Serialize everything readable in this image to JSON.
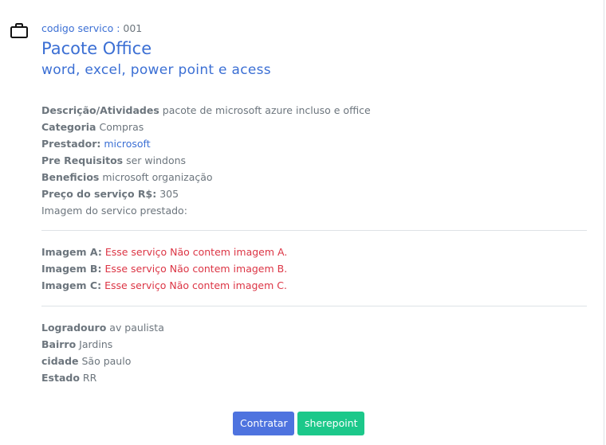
{
  "service": {
    "code_label": "codigo servico :",
    "code_value": "001",
    "title": "Pacote Office",
    "subtitle": "word, excel, power point e acess"
  },
  "details": [
    {
      "label": "Descrição/Atividades",
      "value": "pacote de microsoft azure incluso e office"
    },
    {
      "label": "Categoria",
      "value": "Compras"
    },
    {
      "label": "Prestador:",
      "value": "microsoft"
    },
    {
      "label": "Pre Requisitos",
      "value": "ser windons"
    },
    {
      "label": "Beneficios",
      "value": "microsoft organização"
    },
    {
      "label": "Preço do serviço R$:",
      "value": "305"
    }
  ],
  "image_caption": "Imagem do servico prestado:",
  "images": [
    {
      "label": "Imagem A:",
      "value": "Esse serviço Não contem imagem A."
    },
    {
      "label": "Imagem B:",
      "value": "Esse serviço Não contem imagem B."
    },
    {
      "label": "Imagem C:",
      "value": "Esse serviço Não contem imagem C."
    }
  ],
  "address": [
    {
      "label": "Logradouro",
      "value": "av paulista"
    },
    {
      "label": "Bairro",
      "value": "Jardins"
    },
    {
      "label": "cidade",
      "value": "São paulo"
    },
    {
      "label": "Estado",
      "value": "RR"
    }
  ],
  "buttons": {
    "contratar": "Contratar",
    "sherepoint": "sherepoint"
  },
  "colors": {
    "accent": "#3b6fd4",
    "primary_button": "#4e73df",
    "success_button": "#1cc88a",
    "error_text": "#dc3545",
    "body_text": "#6c757d"
  },
  "icons": {
    "header": "briefcase-icon"
  }
}
